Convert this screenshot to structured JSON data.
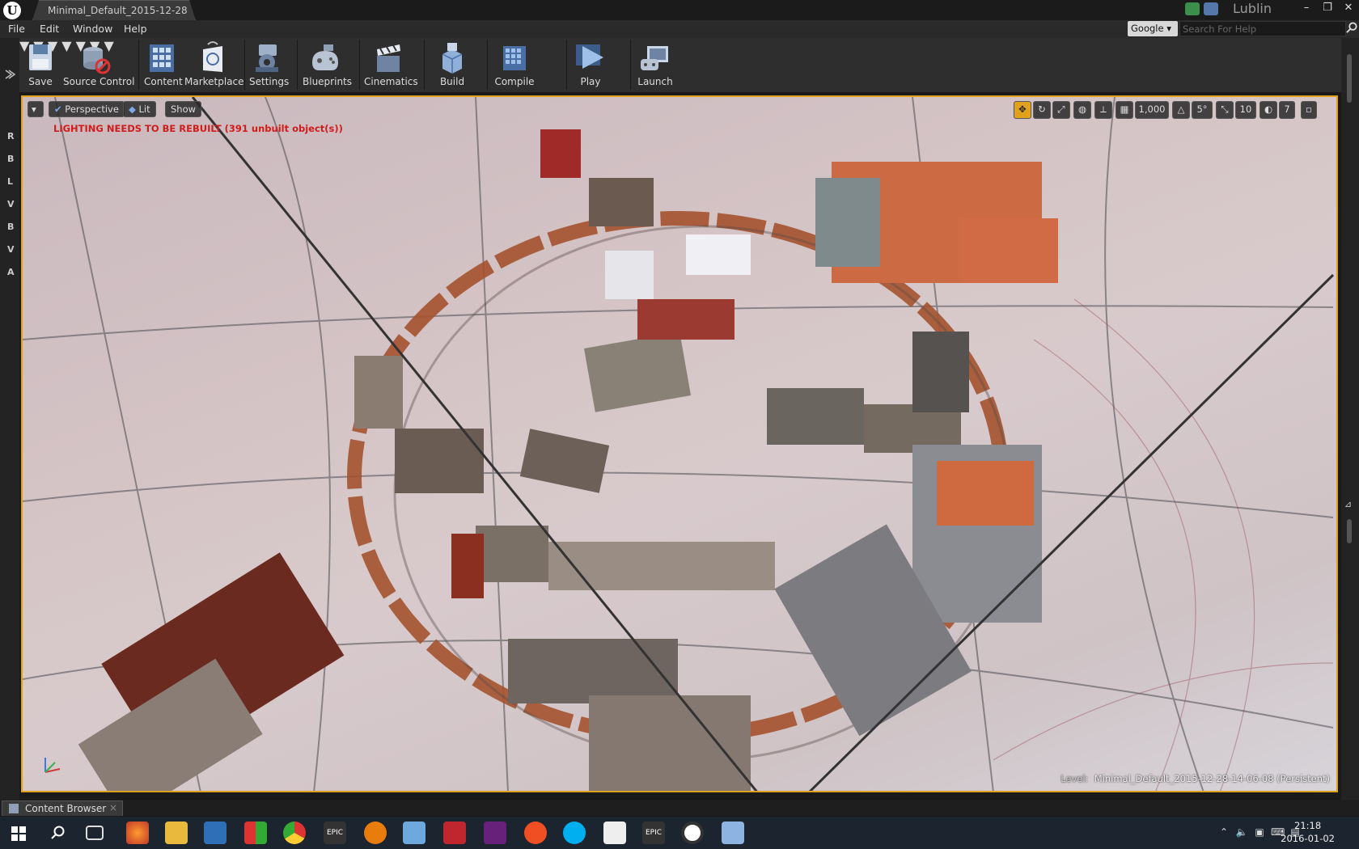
{
  "title_bar": {
    "doc_tab": "Minimal_Default_2015-12-28",
    "project": "Lublin",
    "controls": [
      "–",
      "❐",
      "✕"
    ]
  },
  "menu": {
    "items": [
      "File",
      "Edit",
      "Window",
      "Help"
    ]
  },
  "help_search": {
    "provider": "Google",
    "placeholder": "Search For Help"
  },
  "toolbar": {
    "buttons": [
      {
        "label": "Save",
        "icon": "save-icon"
      },
      {
        "label": "Source Control",
        "icon": "source-control-icon"
      },
      {
        "label": "Content",
        "icon": "content-icon"
      },
      {
        "label": "Marketplace",
        "icon": "marketplace-icon"
      },
      {
        "label": "Settings",
        "icon": "settings-icon"
      },
      {
        "label": "Blueprints",
        "icon": "blueprints-icon"
      },
      {
        "label": "Cinematics",
        "icon": "cinematics-icon"
      },
      {
        "label": "Build",
        "icon": "build-icon"
      },
      {
        "label": "Compile",
        "icon": "compile-icon"
      },
      {
        "label": "Play",
        "icon": "play-icon"
      },
      {
        "label": "Launch",
        "icon": "launch-icon"
      }
    ]
  },
  "mode_tabs": [
    "R",
    "B",
    "L",
    "V",
    "B",
    "V",
    "A"
  ],
  "viewport": {
    "perspective": "Perspective",
    "lit": "Lit",
    "show": "Show",
    "warning": "LIGHTING NEEDS TO BE REBUILT (391 unbuilt object(s))",
    "grid_snap": "1,000",
    "rotation_snap": "5°",
    "scale_snap": "10",
    "camera_speed": "7",
    "level_label": "Level:",
    "level_name": "Minimal_Default_2015-12-28-14-06-08 (Persistent)"
  },
  "bottom": {
    "content_browser": "Content Browser",
    "close": "×"
  },
  "taskbar": {
    "time": "21:18",
    "date": "2016-01-02"
  },
  "colors": {
    "accent": "#e0a21c",
    "warning": "#d11c1c"
  }
}
